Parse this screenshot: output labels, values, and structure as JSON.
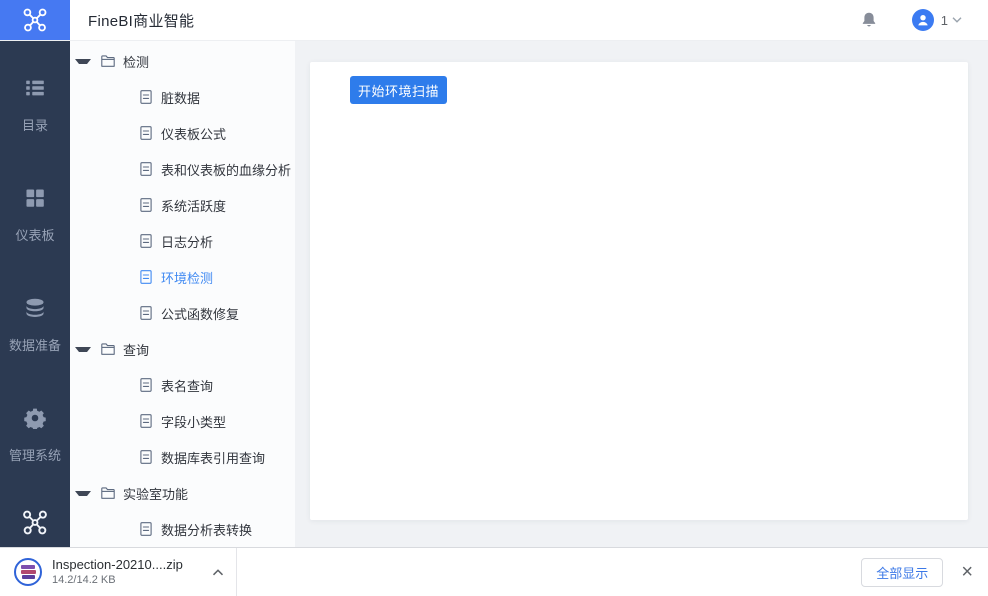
{
  "header": {
    "title": "FineBI商业智能",
    "user_count": "1",
    "bell_icon": "bell-icon",
    "avatar_icon": "user-avatar-icon",
    "chevron_icon": "chevron-down-icon"
  },
  "left_nav": {
    "items": [
      {
        "icon": "list",
        "label": "目录"
      },
      {
        "icon": "grid",
        "label": "仪表板"
      },
      {
        "icon": "database",
        "label": "数据准备"
      },
      {
        "icon": "gear",
        "label": "管理系统"
      }
    ],
    "bottom_icon": "network-icon"
  },
  "tree": {
    "items": [
      {
        "type": "folder",
        "label": "检测",
        "expanded": true
      },
      {
        "type": "doc",
        "label": "脏数据"
      },
      {
        "type": "doc",
        "label": "仪表板公式"
      },
      {
        "type": "doc",
        "label": "表和仪表板的血缘分析"
      },
      {
        "type": "doc",
        "label": "系统活跃度"
      },
      {
        "type": "doc",
        "label": "日志分析"
      },
      {
        "type": "doc",
        "label": "环境检测",
        "selected": true
      },
      {
        "type": "doc",
        "label": "公式函数修复"
      },
      {
        "type": "folder",
        "label": "查询",
        "expanded": true
      },
      {
        "type": "doc",
        "label": "表名查询"
      },
      {
        "type": "doc",
        "label": "字段小类型"
      },
      {
        "type": "doc",
        "label": "数据库表引用查询"
      },
      {
        "type": "folder",
        "label": "实验室功能",
        "expanded": true
      },
      {
        "type": "doc",
        "label": "数据分析表转换"
      }
    ]
  },
  "main": {
    "scan_button": "开始环境扫描"
  },
  "download_bar": {
    "file_name": "Inspection-20210....zip",
    "file_size": "14.2/14.2 KB",
    "file_icon": "zip-archive-icon",
    "expand_icon": "chevron-up-icon",
    "show_all": "全部显示",
    "close_glyph": "×"
  },
  "colors": {
    "logo_blue": "#4679f2",
    "nav_dark": "#2c3a52",
    "button_blue": "#2e7ceb",
    "selected_blue": "#418af2",
    "avatar_blue": "#3b7bf2",
    "link_blue": "#3b78e7"
  }
}
